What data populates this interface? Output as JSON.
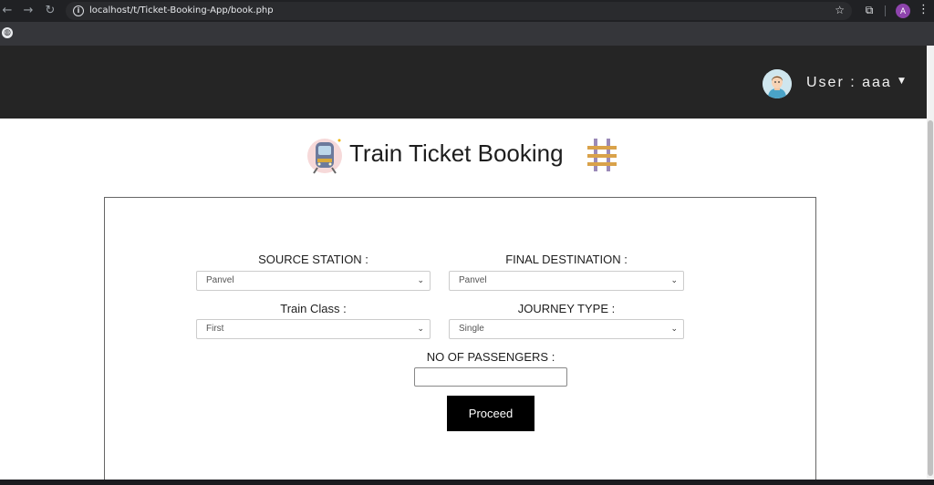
{
  "browser": {
    "url": "localhost/t/Ticket-Booking-App/book.php",
    "profile_initial": "A"
  },
  "header": {
    "user_label": "User : aaa"
  },
  "page": {
    "title": "Train Ticket Booking"
  },
  "form": {
    "source_label": "SOURCE STATION :",
    "source_value": "Panvel",
    "destination_label": "FINAL DESTINATION :",
    "destination_value": "Panvel",
    "class_label": "Train Class :",
    "class_value": "First",
    "journey_label": "JOURNEY TYPE :",
    "journey_value": "Single",
    "passengers_label": "NO OF PASSENGERS :",
    "passengers_value": "",
    "proceed_label": "Proceed"
  },
  "icons": {
    "back": "arrow-left-icon",
    "forward": "arrow-right-icon",
    "reload": "reload-icon",
    "info": "info-icon",
    "star": "star-icon",
    "extensions": "puzzle-icon",
    "menu": "kebab-menu-icon",
    "bookmark": "globe-icon",
    "train": "train-icon",
    "track": "railway-track-icon",
    "avatar": "user-avatar-icon"
  },
  "colors": {
    "header_bg": "#252525",
    "button_bg": "#000000",
    "profile_bg": "#8e44ad"
  }
}
